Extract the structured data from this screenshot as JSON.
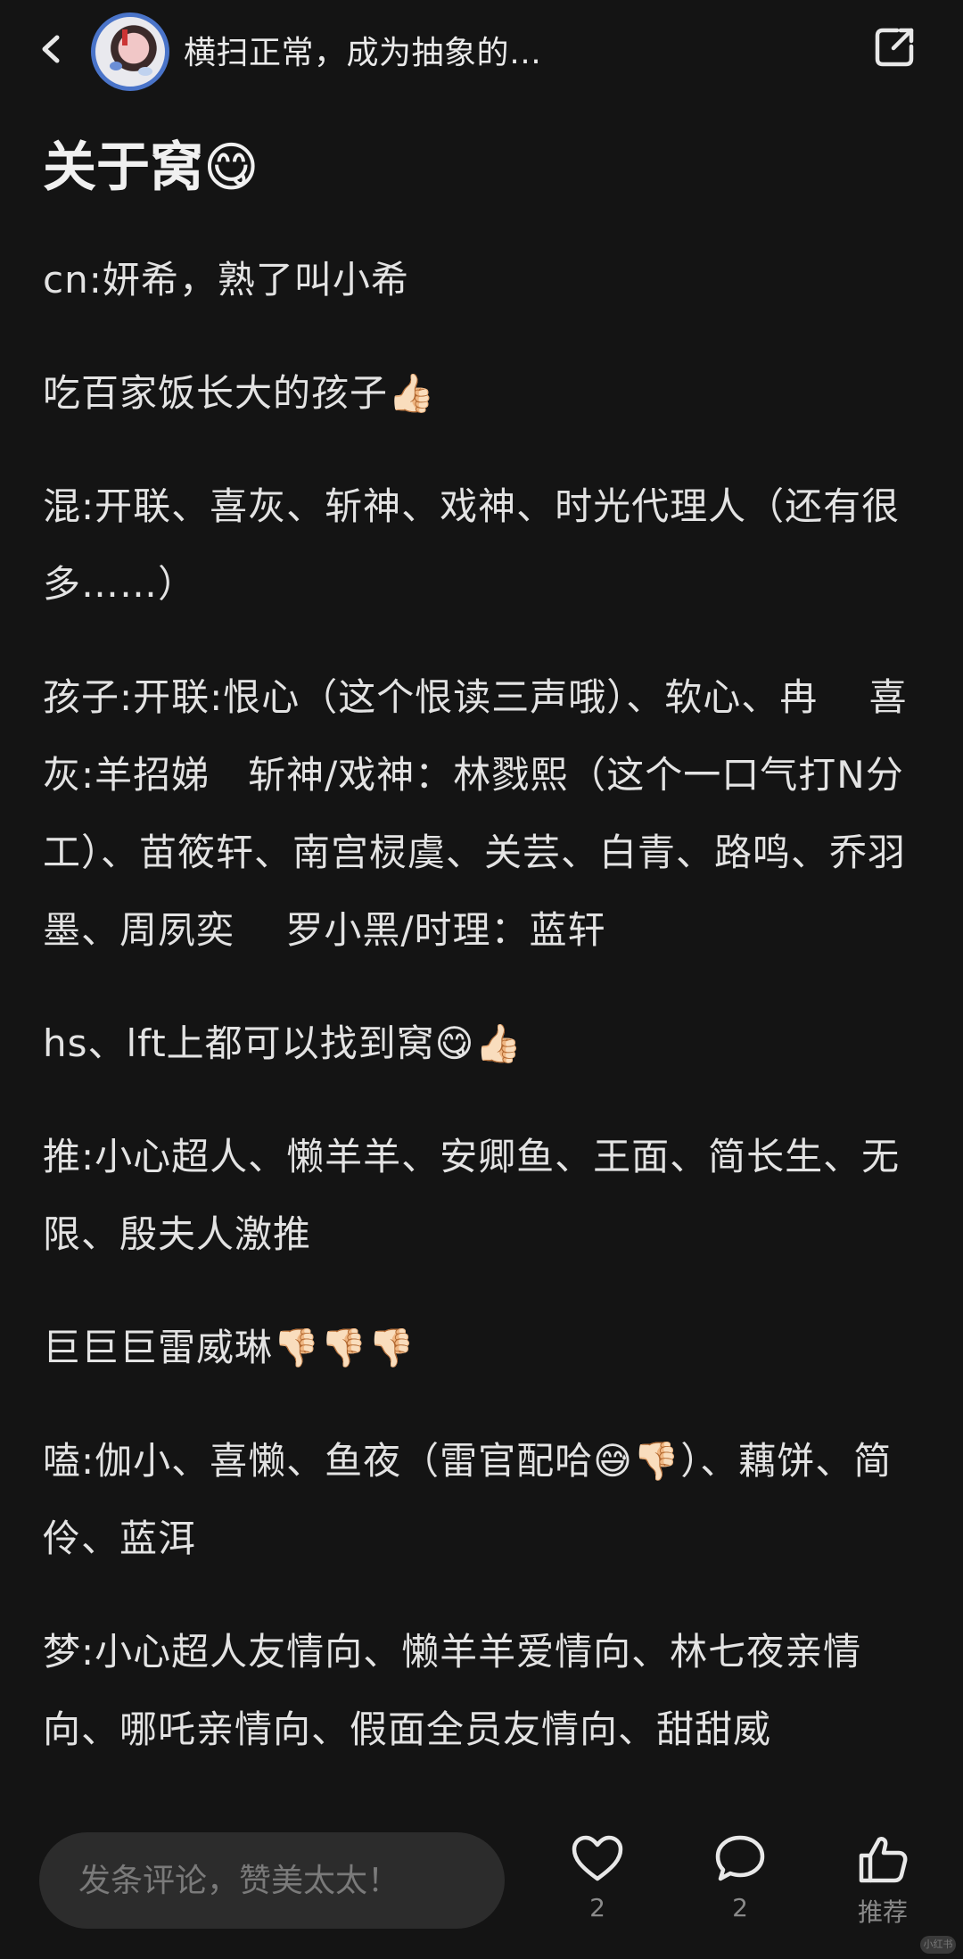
{
  "header": {
    "title": "横扫正常，成为抽象的…",
    "back_icon": "chevron-left-icon",
    "share_icon": "share-external-icon"
  },
  "article": {
    "title": "关于窝😋",
    "paragraphs": [
      "cn:妍希，熟了叫小希",
      "吃百家饭长大的孩子👍🏻",
      "混:开联、喜灰、斩神、戏神、时光代理人（还有很多……）",
      "孩子:开联:恨心（这个恨读三声哦）、软心、冉　 喜灰:羊招娣　斩神/戏神：林戮熙（这个一口气打N分工）、苗筱轩、南宫棂虞、关芸、白青、路鸣、乔羽墨、周夙奕　 罗小黑/时理：蓝轩",
      "hs、lft上都可以找到窝😋👍🏻",
      "推:小心超人、懒羊羊、安卿鱼、王面、简长生、无限、殷夫人激推",
      "巨巨巨雷威琳👎🏻👎🏻👎🏻",
      "嗑:伽小、喜懒、鱼夜（雷官配哈😅👎🏻）、藕饼、简伶、蓝洱",
      "梦:小心超人友情向、懒羊羊爱情向、林七夜亲情向、哪吒亲情向、假面全员友情向、甜甜威"
    ]
  },
  "bottom_bar": {
    "comment_placeholder": "发条评论，赞美太太！",
    "like_count": "2",
    "comment_count": "2",
    "recommend_label": "推荐"
  },
  "watermark": "小红书"
}
